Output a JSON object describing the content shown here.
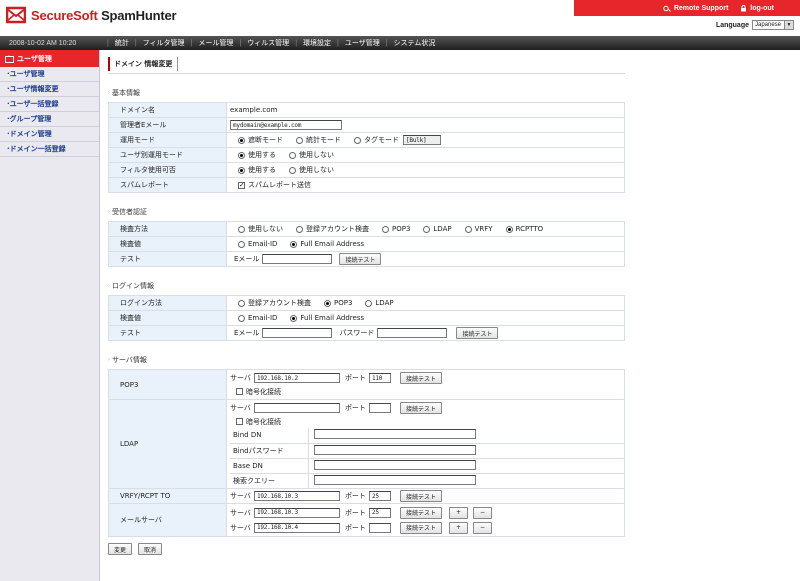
{
  "app": {
    "brand_red": "SecureSoft",
    "brand_dark": "SpamHunter",
    "remote_support": "Remote Support",
    "logout": "log-out",
    "language_label": "Language",
    "language_value": "Japanese"
  },
  "navbar": {
    "datetime": "2008-10-02 AM 10:20",
    "items": [
      "統計",
      "フィルタ管理",
      "メール管理",
      "ウィルス管理",
      "環境設定",
      "ユーザ管理",
      "システム状況"
    ]
  },
  "sidebar": {
    "title": "ユーザ管理",
    "items": [
      "ユーザ管理",
      "ユーザ情報変更",
      "ユーザ一括登録",
      "グループ管理",
      "ドメイン管理",
      "ドメイン一括登録"
    ]
  },
  "page": {
    "title": "ドメイン 情報変更"
  },
  "basic": {
    "section": "基本情報",
    "domain_label": "ドメイン名",
    "domain_value": "example.com",
    "admin_email_label": "管理者Eメール",
    "admin_email_value": "mydomain@example.com",
    "mode_label": "運用モード",
    "mode_opts": [
      "遮断モード",
      "統計モード",
      "タグモード"
    ],
    "tag_value": "[Bulk]",
    "user_mode_label": "ユーザ別運用モード",
    "filter_label": "フィルタ使用可否",
    "use": "使用する",
    "not_use": "使用しない",
    "spam_report_label": "スパムレポート",
    "spam_report_opt": "スパムレポート送信"
  },
  "recipient": {
    "section": "受信者認証",
    "method_label": "検査方法",
    "method_opts": [
      "使用しない",
      "登録アカウント検査",
      "POP3",
      "LDAP",
      "VRFY",
      "RCPTTO"
    ],
    "value_label": "検査値",
    "value_opts": [
      "Email-ID",
      "Full Email Address"
    ],
    "test_label": "テスト",
    "email_label": "Eメール",
    "test_button": "接続テスト"
  },
  "login": {
    "section": "ログイン情報",
    "method_label": "ログイン方法",
    "method_opts": [
      "登録アカウント検査",
      "POP3",
      "LDAP"
    ],
    "value_label": "検査値",
    "value_opts": [
      "Email-ID",
      "Full Email Address"
    ],
    "test_label": "テスト",
    "email_label": "Eメール",
    "password_label": "パスワード",
    "test_button": "接続テスト"
  },
  "server": {
    "section": "サーバ情報",
    "server_label": "サーバ",
    "port_label": "ポート",
    "test_button": "接続テスト",
    "encrypt_label": "暗号化接続",
    "pop3_label": "POP3",
    "pop3_server": "192.168.10.2",
    "pop3_port": "110",
    "ldap_label": "LDAP",
    "ldap_server": "",
    "ldap_port": "",
    "bind_dn_label": "Bind DN",
    "bind_pw_label": "Bindパスワード",
    "base_dn_label": "Base DN",
    "query_label": "検索クエリー",
    "vrfy_label": "VRFY/RCPT TO",
    "vrfy_server": "192.168.10.3",
    "vrfy_port": "25",
    "mail_label": "メールサーバ",
    "mail1_server": "192.168.10.3",
    "mail1_port": "25",
    "mail2_server": "192.168.10.4",
    "mail2_port": "",
    "plus": "+",
    "minus": "−"
  },
  "actions": {
    "change": "変更",
    "cancel": "取消"
  }
}
